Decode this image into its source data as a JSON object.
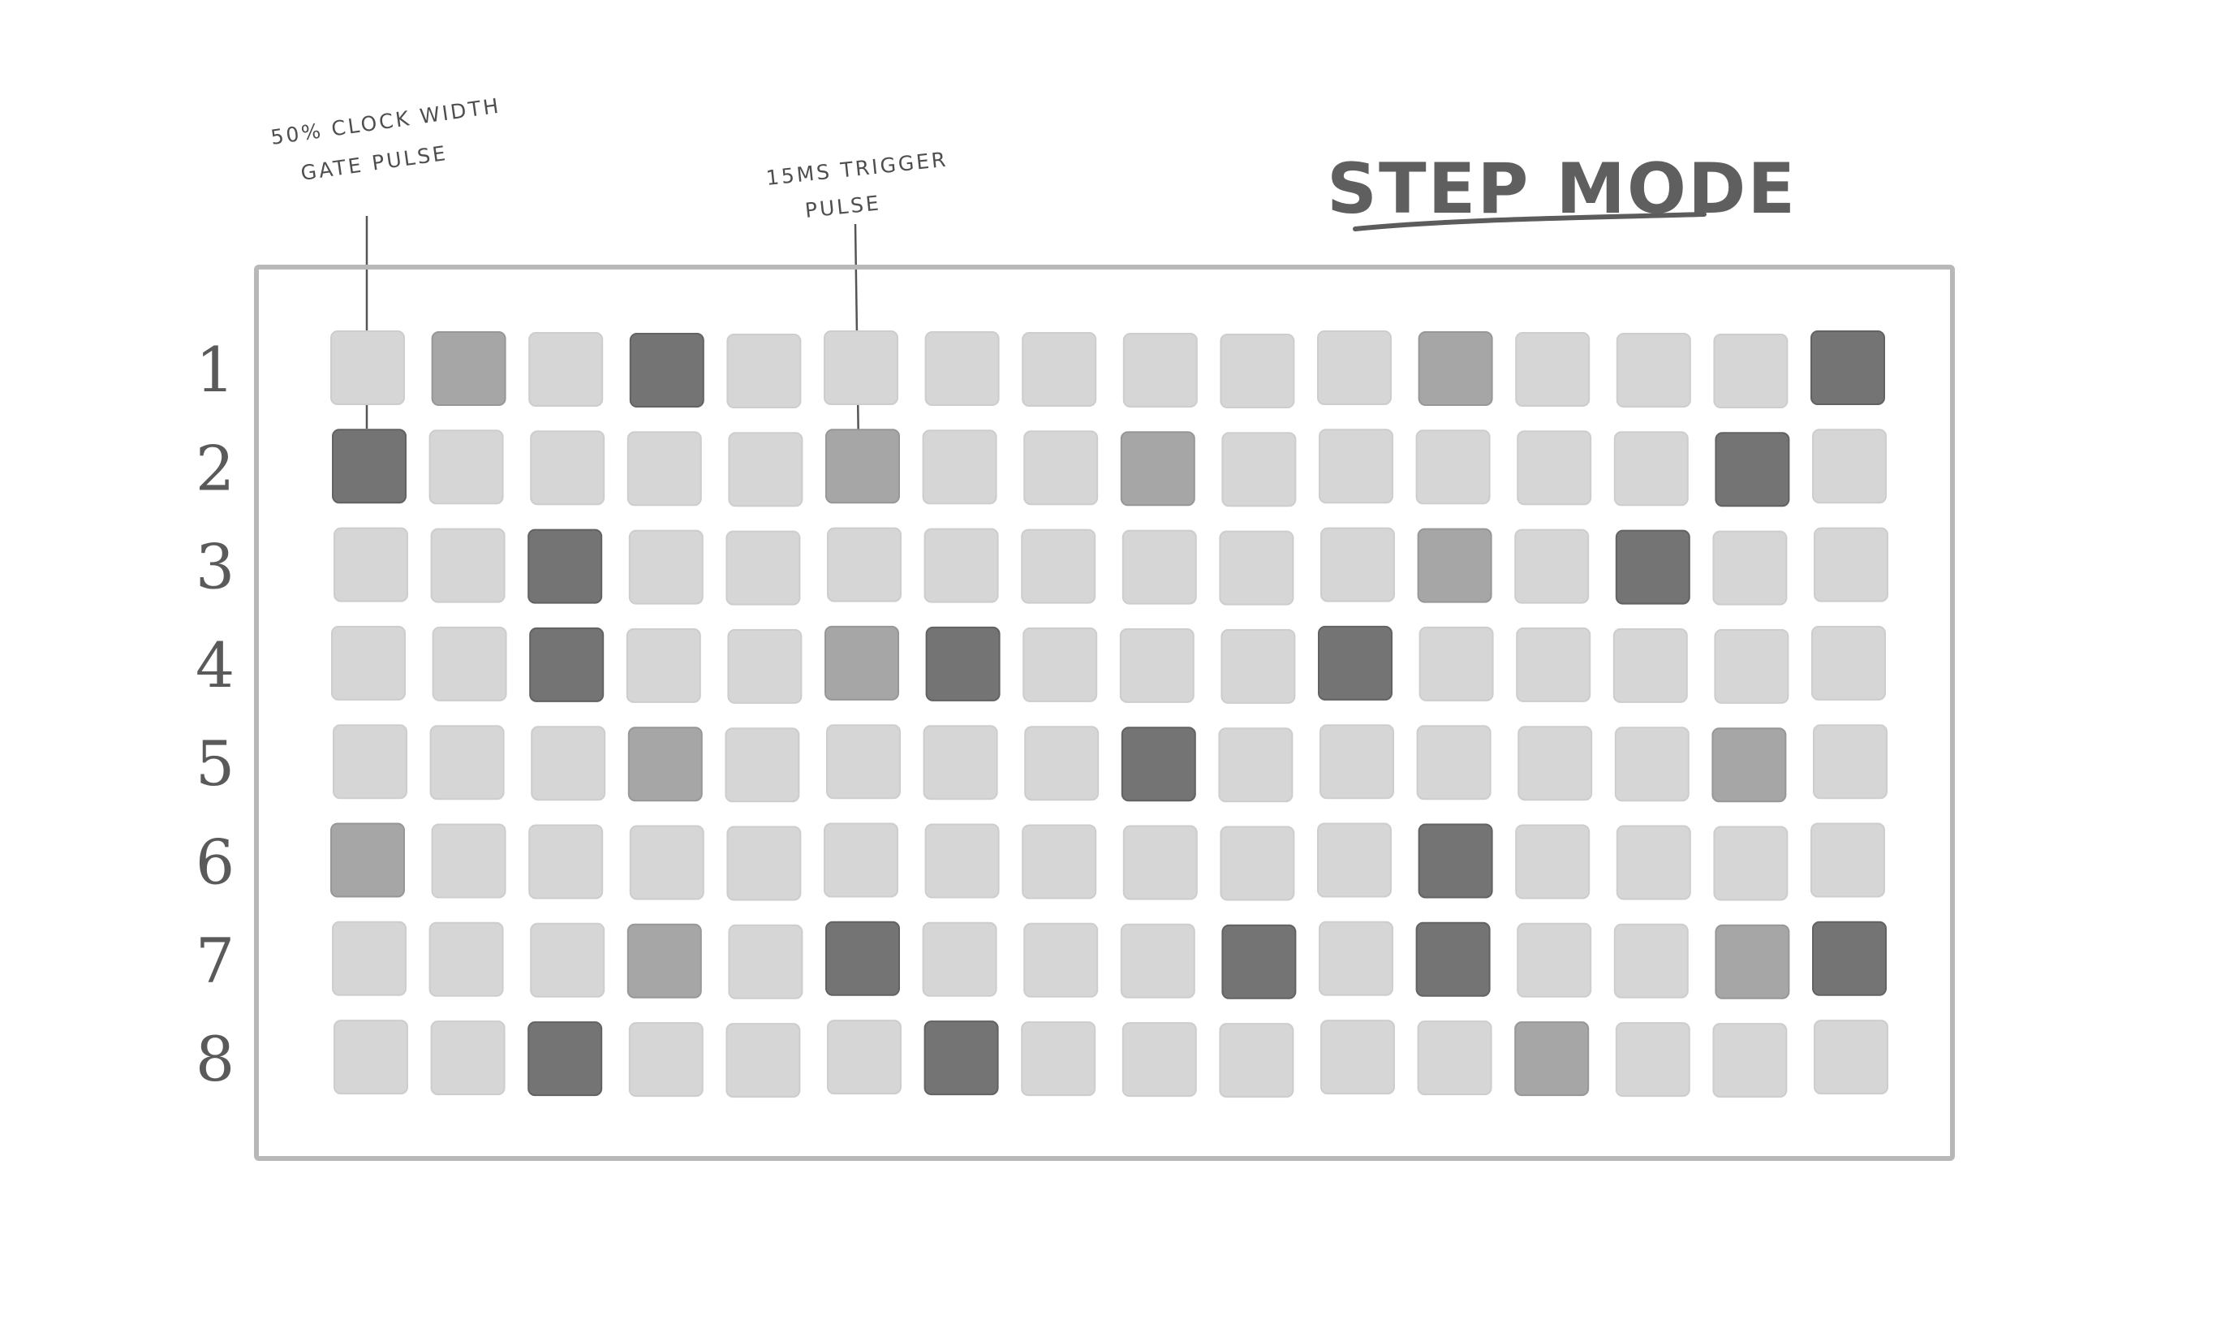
{
  "title": "STEP MODE",
  "annotations": [
    {
      "lines": [
        "50% CLOCK WIDTH",
        "GATE PULSE"
      ]
    },
    {
      "lines": [
        "15MS TRIGGER",
        "PULSE"
      ]
    }
  ],
  "legend_colors": {
    "off": "#d6d6d6",
    "trigger": "#a6a6a6",
    "gate": "#747474"
  },
  "rows": [
    {
      "label": "1",
      "steps": [
        0,
        1,
        0,
        2,
        0,
        0,
        0,
        0,
        0,
        0,
        0,
        1,
        0,
        0,
        0,
        2
      ]
    },
    {
      "label": "2",
      "steps": [
        2,
        0,
        0,
        0,
        0,
        1,
        0,
        0,
        1,
        0,
        0,
        0,
        0,
        0,
        2,
        0
      ]
    },
    {
      "label": "3",
      "steps": [
        0,
        0,
        2,
        0,
        0,
        0,
        0,
        0,
        0,
        0,
        0,
        1,
        0,
        2,
        0,
        0
      ]
    },
    {
      "label": "4",
      "steps": [
        0,
        0,
        2,
        0,
        0,
        1,
        2,
        0,
        0,
        0,
        2,
        0,
        0,
        0,
        0,
        0
      ]
    },
    {
      "label": "5",
      "steps": [
        0,
        0,
        0,
        1,
        0,
        0,
        0,
        0,
        2,
        0,
        0,
        0,
        0,
        0,
        1,
        0
      ]
    },
    {
      "label": "6",
      "steps": [
        1,
        0,
        0,
        0,
        0,
        0,
        0,
        0,
        0,
        0,
        0,
        2,
        0,
        0,
        0,
        0
      ]
    },
    {
      "label": "7",
      "steps": [
        0,
        0,
        0,
        1,
        0,
        2,
        0,
        0,
        0,
        2,
        0,
        2,
        0,
        0,
        1,
        2
      ]
    },
    {
      "label": "8",
      "steps": [
        0,
        0,
        2,
        0,
        0,
        0,
        2,
        0,
        0,
        0,
        0,
        0,
        1,
        0,
        0,
        0
      ]
    }
  ]
}
